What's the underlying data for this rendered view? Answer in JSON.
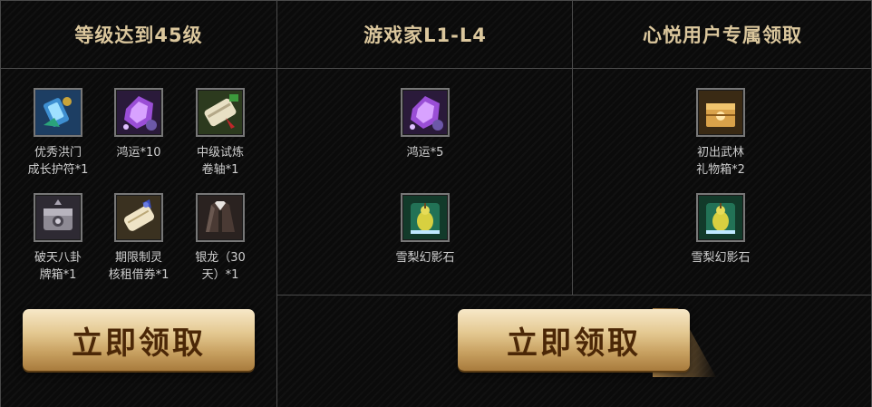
{
  "panels": [
    {
      "title": "等级达到45级",
      "items": [
        {
          "label": "优秀洪门\n成长护符*1",
          "icon": "charm-icon"
        },
        {
          "label": "鸿运*10",
          "icon": "purple-crystal-icon"
        },
        {
          "label": "中级试炼\n卷轴*1",
          "icon": "scroll-icon"
        },
        {
          "label": "破天八卦\n牌箱*1",
          "icon": "chest-icon"
        },
        {
          "label": "期限制灵\n核租借券*1",
          "icon": "scroll-ribbon-icon"
        },
        {
          "label": "银龙（30\n天）*1",
          "icon": "coat-icon"
        }
      ],
      "button_label": "立即领取"
    },
    {
      "title": "游戏家L1-L4",
      "items": [
        {
          "label": "鸿运*5",
          "icon": "purple-crystal-icon"
        },
        {
          "label": "雪梨幻影石",
          "icon": "pear-stone-icon"
        }
      ]
    },
    {
      "title": "心悦用户专属领取",
      "items": [
        {
          "label": "初出武林\n礼物箱*2",
          "icon": "gift-box-icon"
        },
        {
          "label": "雪梨幻影石",
          "icon": "pear-stone-icon"
        }
      ],
      "button_label": "立即领取"
    }
  ]
}
